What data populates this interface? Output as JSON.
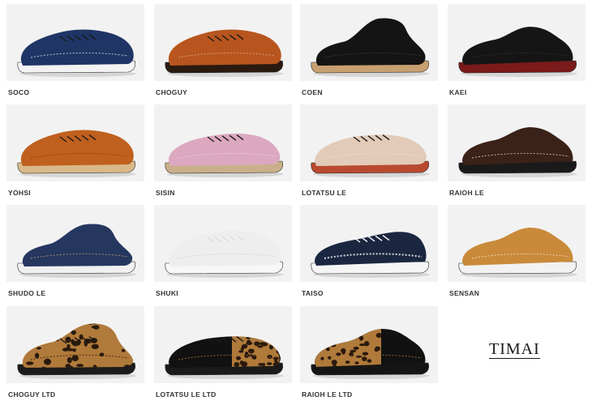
{
  "brand": "TIMAI",
  "products": [
    {
      "name": "SOCO",
      "upper": "#1f3566",
      "sole": "#f3f3f3",
      "accent": "#e8e8e8",
      "style": "lace"
    },
    {
      "name": "CHOGUY",
      "upper": "#b8551f",
      "sole": "#2a1a10",
      "accent": "#e0b090",
      "style": "lace"
    },
    {
      "name": "COEN",
      "upper": "#141414",
      "sole": "#c8a070",
      "accent": "#444444",
      "style": "boot"
    },
    {
      "name": "KAEI",
      "upper": "#151515",
      "sole": "#7a1a1a",
      "accent": "#333333",
      "style": "moc"
    },
    {
      "name": "YOHSI",
      "upper": "#c0601e",
      "sole": "#d9b98a",
      "accent": "#7a3a10",
      "style": "lace"
    },
    {
      "name": "SISIN",
      "upper": "#dba8c0",
      "sole": "#c9b08a",
      "accent": "#f0d8e4",
      "style": "wing"
    },
    {
      "name": "LOTATSU LE",
      "upper": "#e2cbb8",
      "sole": "#b94a30",
      "accent": "#f4e6da",
      "style": "derby"
    },
    {
      "name": "RAIOH LE",
      "upper": "#3a2218",
      "sole": "#1a1a1a",
      "accent": "#e8d8b8",
      "style": "moc"
    },
    {
      "name": "SHUDO LE",
      "upper": "#25375f",
      "sole": "#f0f0f0",
      "accent": "#c9a36a",
      "style": "chukka"
    },
    {
      "name": "SHUKI",
      "upper": "#eeeeee",
      "sole": "#f7f7f7",
      "accent": "#cccccc",
      "style": "lace"
    },
    {
      "name": "TAISO",
      "upper": "#1b2740",
      "sole": "#f5f5f5",
      "accent": "#ffffff",
      "style": "sneaker"
    },
    {
      "name": "SENSAN",
      "upper": "#c98a3a",
      "sole": "#f2f2f2",
      "accent": "#f5e7cf",
      "style": "moc"
    },
    {
      "name": "CHOGUY LTD",
      "upper": "#b07a3a",
      "sole": "#1c1c1c",
      "accent": "#2a1a10",
      "style": "leopard"
    },
    {
      "name": "LOTATSU LE LTD",
      "upper": "#111111",
      "sole": "#1a1a1a",
      "accent": "#b07a3a",
      "style": "leopard-derby"
    },
    {
      "name": "RAIOH LE LTD",
      "upper": "#111111",
      "sole": "#151515",
      "accent": "#b07a3a",
      "style": "leopard-moc"
    }
  ]
}
